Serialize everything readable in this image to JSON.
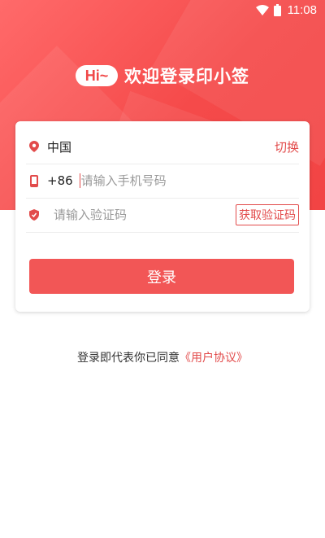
{
  "status_bar": {
    "time": "11:08",
    "icons": [
      "wifi-icon",
      "battery-icon"
    ]
  },
  "header": {
    "hi_badge": "Hi~",
    "welcome_text": "欢迎登录印小签"
  },
  "form": {
    "country_label": "中国",
    "switch_label": "切换",
    "phone_prefix": "+86",
    "phone_placeholder": "请输入手机号码",
    "code_placeholder": "请输入验证码",
    "get_code_label": "获取验证码",
    "login_label": "登录"
  },
  "agreement": {
    "text": "登录即代表你已同意",
    "link": "《用户协议》"
  },
  "colors": {
    "primary": "#f25656",
    "accent_text": "#e24b4b"
  }
}
